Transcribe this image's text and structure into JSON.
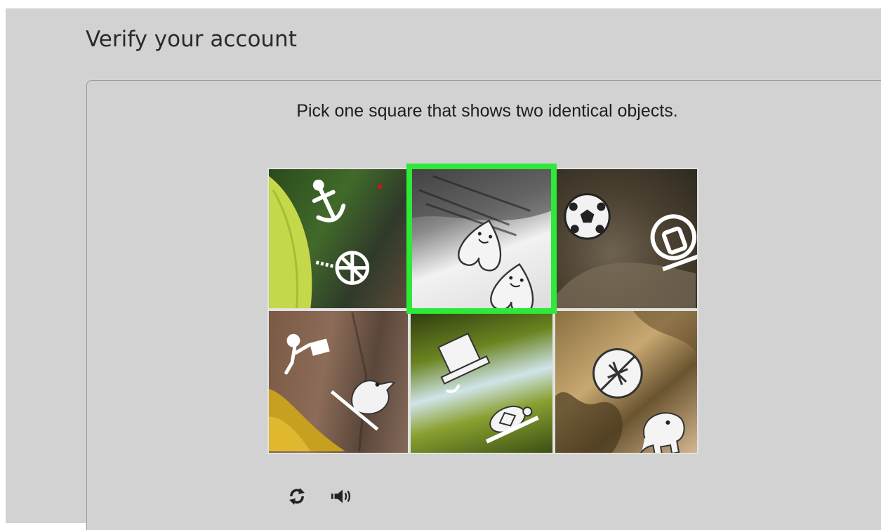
{
  "page": {
    "title": "Verify your account"
  },
  "captcha": {
    "instruction": "Pick one square that shows two identical objects.",
    "selected_tile": 2,
    "tiles": [
      {
        "icons": [
          "anchor-icon",
          "wheel-icon"
        ]
      },
      {
        "icons": [
          "heart-face-icon",
          "heart-face-icon"
        ]
      },
      {
        "icons": [
          "soccer-ball-icon",
          "lightbulb-icon"
        ]
      },
      {
        "icons": [
          "runner-icon",
          "bird-icon"
        ]
      },
      {
        "icons": [
          "hat-icon",
          "turtle-icon"
        ]
      },
      {
        "icons": [
          "stop-sign-icon",
          "elephant-icon"
        ]
      }
    ],
    "controls": {
      "refresh_icon": "refresh-icon",
      "audio_icon": "audio-icon"
    },
    "colors": {
      "selection": "#2ee83a",
      "background": "#d2d2d2"
    }
  }
}
